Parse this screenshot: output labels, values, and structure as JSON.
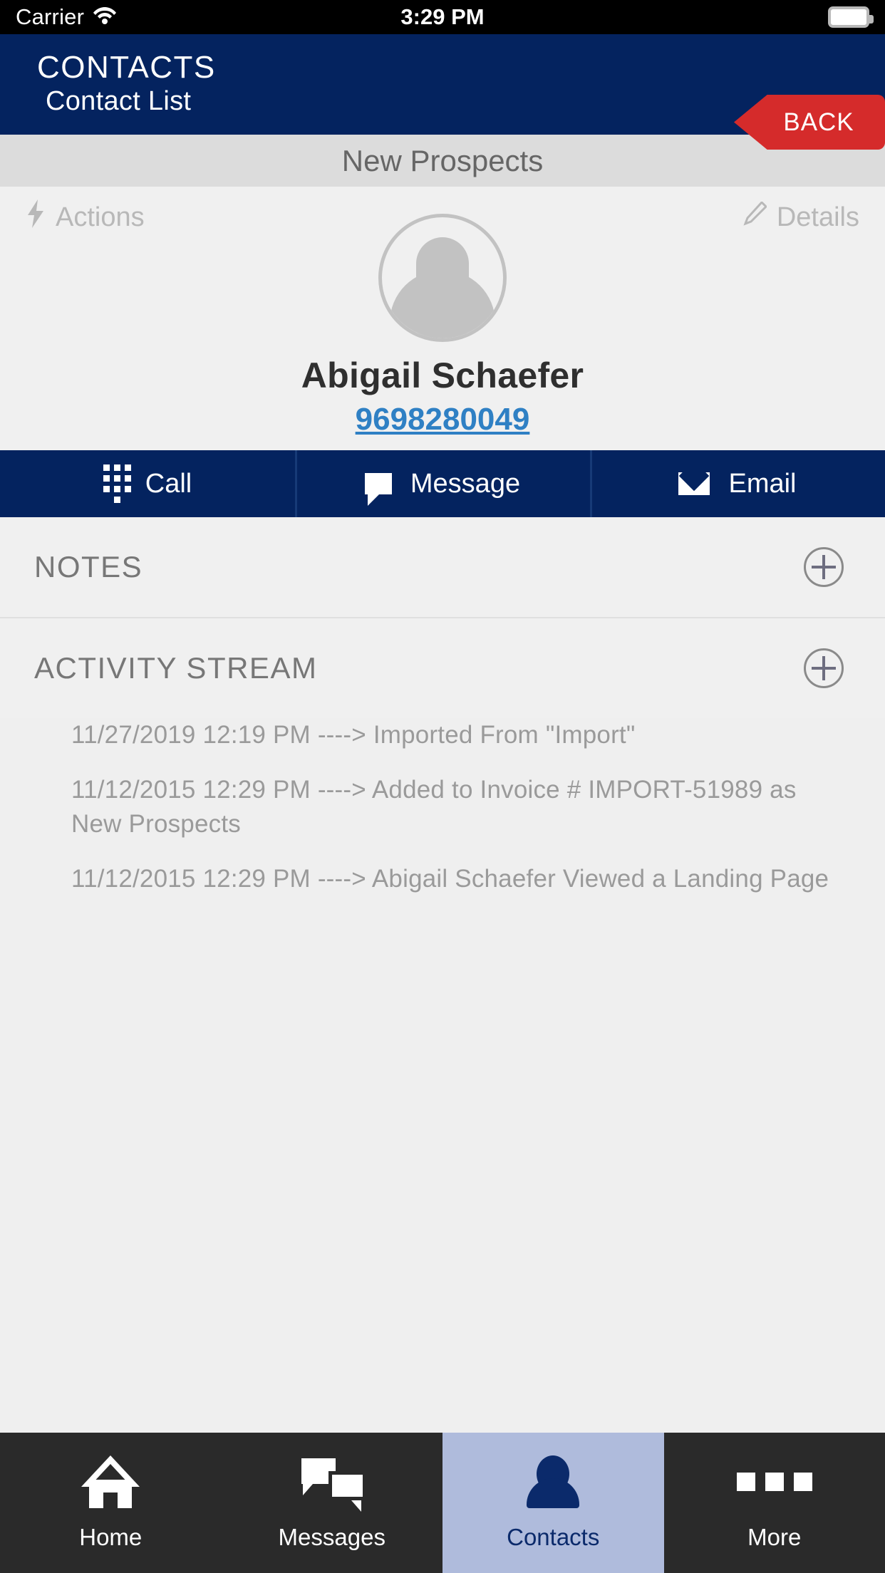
{
  "status_bar": {
    "carrier": "Carrier",
    "time": "3:29 PM",
    "wifi_icon": "wifi-icon",
    "battery_icon": "battery-icon"
  },
  "header": {
    "title": "CONTACTS",
    "subtitle": "Contact List",
    "back_label": "BACK",
    "bg_color": "#04235F",
    "back_color": "#D52B2B"
  },
  "list_bar": {
    "title": "New Prospects"
  },
  "contact": {
    "actions_label": "Actions",
    "details_label": "Details",
    "actions_icon": "lightning-bolt-icon",
    "details_icon": "pencil-icon",
    "avatar_icon": "person-placeholder-avatar",
    "name": "Abigail Schaefer",
    "phone": "9698280049",
    "phone_color": "#2F80C4"
  },
  "action_bar": {
    "buttons": [
      {
        "label": "Call",
        "icon": "dialpad-icon"
      },
      {
        "label": "Message",
        "icon": "speech-bubble-icon"
      },
      {
        "label": "Email",
        "icon": "envelope-icon"
      }
    ]
  },
  "notes": {
    "title": "NOTES",
    "add_icon": "plus-circle-icon"
  },
  "activity_stream": {
    "title": "ACTIVITY STREAM",
    "add_icon": "plus-circle-icon",
    "items": [
      "11/27/2019 12:19 PM ----> Imported From \"Import\"",
      "11/12/2015 12:29 PM ----> Added to Invoice # IMPORT-51989 as New Prospects",
      "11/12/2015 12:29 PM ----> Abigail Schaefer Viewed a Landing Page"
    ]
  },
  "tab_bar": {
    "active_index": 2,
    "active_bg": "#AFBBDC",
    "bg": "#2A2A2A",
    "tabs": [
      {
        "label": "Home",
        "icon": "home-icon"
      },
      {
        "label": "Messages",
        "icon": "messages-icon"
      },
      {
        "label": "Contacts",
        "icon": "person-icon"
      },
      {
        "label": "More",
        "icon": "ellipsis-icon"
      }
    ]
  }
}
